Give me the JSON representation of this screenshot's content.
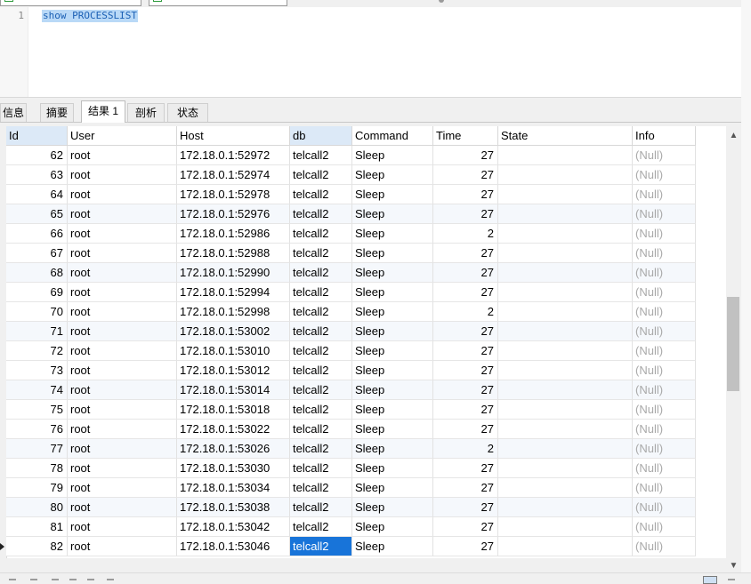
{
  "editor": {
    "line_number": "1",
    "sql": "show PROCESSLIST"
  },
  "tabs": [
    {
      "label": "信息"
    },
    {
      "label": "摘要"
    },
    {
      "label": "结果 1"
    },
    {
      "label": "剖析"
    },
    {
      "label": "状态"
    }
  ],
  "active_tab": 2,
  "grid": {
    "columns": [
      "Id",
      "User",
      "Host",
      "db",
      "Command",
      "Time",
      "State",
      "Info"
    ],
    "rows": [
      [
        "62",
        "root",
        "172.18.0.1:52972",
        "telcall2",
        "Sleep",
        "27",
        "",
        "(Null)"
      ],
      [
        "63",
        "root",
        "172.18.0.1:52974",
        "telcall2",
        "Sleep",
        "27",
        "",
        "(Null)"
      ],
      [
        "64",
        "root",
        "172.18.0.1:52978",
        "telcall2",
        "Sleep",
        "27",
        "",
        "(Null)"
      ],
      [
        "65",
        "root",
        "172.18.0.1:52976",
        "telcall2",
        "Sleep",
        "27",
        "",
        "(Null)"
      ],
      [
        "66",
        "root",
        "172.18.0.1:52986",
        "telcall2",
        "Sleep",
        "2",
        "",
        "(Null)"
      ],
      [
        "67",
        "root",
        "172.18.0.1:52988",
        "telcall2",
        "Sleep",
        "27",
        "",
        "(Null)"
      ],
      [
        "68",
        "root",
        "172.18.0.1:52990",
        "telcall2",
        "Sleep",
        "27",
        "",
        "(Null)"
      ],
      [
        "69",
        "root",
        "172.18.0.1:52994",
        "telcall2",
        "Sleep",
        "27",
        "",
        "(Null)"
      ],
      [
        "70",
        "root",
        "172.18.0.1:52998",
        "telcall2",
        "Sleep",
        "2",
        "",
        "(Null)"
      ],
      [
        "71",
        "root",
        "172.18.0.1:53002",
        "telcall2",
        "Sleep",
        "27",
        "",
        "(Null)"
      ],
      [
        "72",
        "root",
        "172.18.0.1:53010",
        "telcall2",
        "Sleep",
        "27",
        "",
        "(Null)"
      ],
      [
        "73",
        "root",
        "172.18.0.1:53012",
        "telcall2",
        "Sleep",
        "27",
        "",
        "(Null)"
      ],
      [
        "74",
        "root",
        "172.18.0.1:53014",
        "telcall2",
        "Sleep",
        "27",
        "",
        "(Null)"
      ],
      [
        "75",
        "root",
        "172.18.0.1:53018",
        "telcall2",
        "Sleep",
        "27",
        "",
        "(Null)"
      ],
      [
        "76",
        "root",
        "172.18.0.1:53022",
        "telcall2",
        "Sleep",
        "27",
        "",
        "(Null)"
      ],
      [
        "77",
        "root",
        "172.18.0.1:53026",
        "telcall2",
        "Sleep",
        "2",
        "",
        "(Null)"
      ],
      [
        "78",
        "root",
        "172.18.0.1:53030",
        "telcall2",
        "Sleep",
        "27",
        "",
        "(Null)"
      ],
      [
        "79",
        "root",
        "172.18.0.1:53034",
        "telcall2",
        "Sleep",
        "27",
        "",
        "(Null)"
      ],
      [
        "80",
        "root",
        "172.18.0.1:53038",
        "telcall2",
        "Sleep",
        "27",
        "",
        "(Null)"
      ],
      [
        "81",
        "root",
        "172.18.0.1:53042",
        "telcall2",
        "Sleep",
        "27",
        "",
        "(Null)"
      ],
      [
        "82",
        "root",
        "172.18.0.1:53046",
        "telcall2",
        "Sleep",
        "27",
        "",
        "(Null)"
      ]
    ],
    "alt_rows": [
      3,
      6,
      9,
      12,
      15,
      18
    ],
    "selected_row": 20,
    "selected_column": 3
  },
  "colors": {
    "selection": "#1874d9",
    "sql_text": "#1a5fb4",
    "null_text": "#a9a9a9"
  },
  "icons": [
    "scroll-up-icon",
    "scroll-down-icon",
    "current-row-icon"
  ]
}
